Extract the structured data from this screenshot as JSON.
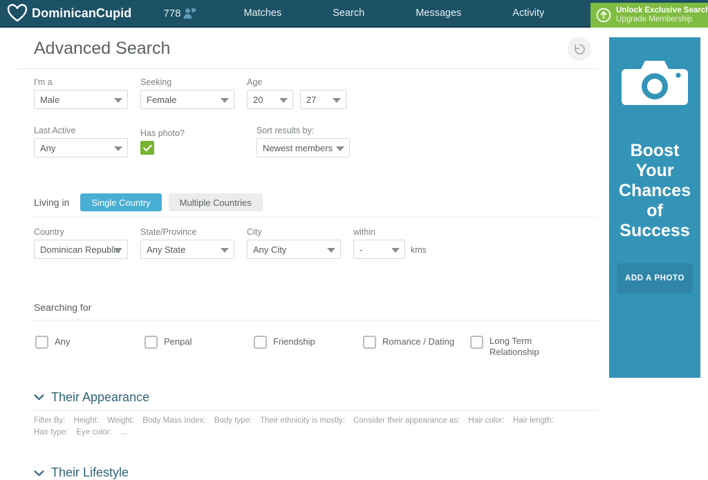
{
  "nav": {
    "brand": "DominicanCupid",
    "brand_icon": "heart-icon",
    "member_count": "778",
    "member_icon": "people-icon",
    "links": [
      {
        "label": "Matches"
      },
      {
        "label": "Search"
      },
      {
        "label": "Messages"
      },
      {
        "label": "Activity"
      }
    ],
    "cta": {
      "icon": "up-arrow-circle-icon",
      "line1": "Unlock Exclusive Search Fea",
      "line2": "Upgrade Membership"
    },
    "colors": {
      "bar": "#1c5166",
      "cta": "#80bc42"
    }
  },
  "page": {
    "title": "Advanced Search",
    "reset_icon": "reset-arrow-icon"
  },
  "basic": {
    "im_a": {
      "label": "I'm a",
      "value": "Male"
    },
    "seeking": {
      "label": "Seeking",
      "value": "Female"
    },
    "age": {
      "label": "Age",
      "from": "20",
      "to": "27"
    },
    "last_active": {
      "label": "Last Active",
      "value": "Any"
    },
    "has_photo": {
      "label": "Has photo?",
      "checked": true,
      "check_icon": "checkmark-icon"
    },
    "sort_by": {
      "label": "Sort results by:",
      "value": "Newest members"
    }
  },
  "living_in": {
    "label": "Living in",
    "tabs": [
      {
        "label": "Single Country",
        "active": true
      },
      {
        "label": "Multiple Countries",
        "active": false
      }
    ],
    "country": {
      "label": "Country",
      "value": "Dominican Republic"
    },
    "state": {
      "label": "State/Province",
      "value": "Any State"
    },
    "city": {
      "label": "City",
      "value": "Any City"
    },
    "within": {
      "label": "within",
      "value": "-",
      "unit": "kms"
    },
    "active_tab_color": "#49aed4"
  },
  "searching_for": {
    "label": "Searching for",
    "options": [
      {
        "label": "Any",
        "checked": false
      },
      {
        "label": "Penpal",
        "checked": false
      },
      {
        "label": "Friendship",
        "checked": false
      },
      {
        "label": "Romance / Dating",
        "checked": false
      },
      {
        "label": "Long Term Relationship",
        "checked": false
      }
    ]
  },
  "sections": [
    {
      "title": "Their Appearance",
      "chevron": "chevron-down-icon",
      "filters": [
        "Filter By:",
        "Height:",
        "Weight:",
        "Body Mass Index:",
        "Body type:",
        "Their ethnicity is mostly:",
        "Consider their appearance as:",
        "Hair color:",
        "Hair length:",
        "Hair type:",
        "Eye color:",
        "..."
      ]
    },
    {
      "title": "Their Lifestyle",
      "chevron": "chevron-down-icon",
      "filters": []
    }
  ],
  "ad": {
    "icon": "camera-icon",
    "headline": "Boost\nYour\nChances\nof\nSuccess",
    "button": "ADD A PHOTO",
    "bg_color": "#3494b8"
  }
}
